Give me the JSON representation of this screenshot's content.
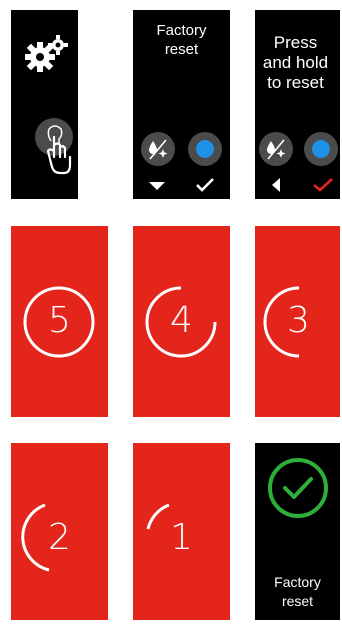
{
  "colors": {
    "red_bg": "#e3251b",
    "black_bg": "#000000",
    "button_gray": "#4b4b4b",
    "blue_dot": "#1e90e6",
    "confirm_red": "#e3251b",
    "success_green": "#2fae3a"
  },
  "screens": {
    "settings": {
      "icons": [
        "gears-icon",
        "touch-hand-icon"
      ]
    },
    "factory_reset_menu": {
      "title_line1": "Factory",
      "title_line2": "reset"
    },
    "press_hold": {
      "line1": "Press",
      "line2": "and hold",
      "line3": "to reset"
    },
    "countdown": [
      "5",
      "4",
      "3",
      "2",
      "1"
    ],
    "done": {
      "line1": "Factory",
      "line2": "reset"
    }
  }
}
